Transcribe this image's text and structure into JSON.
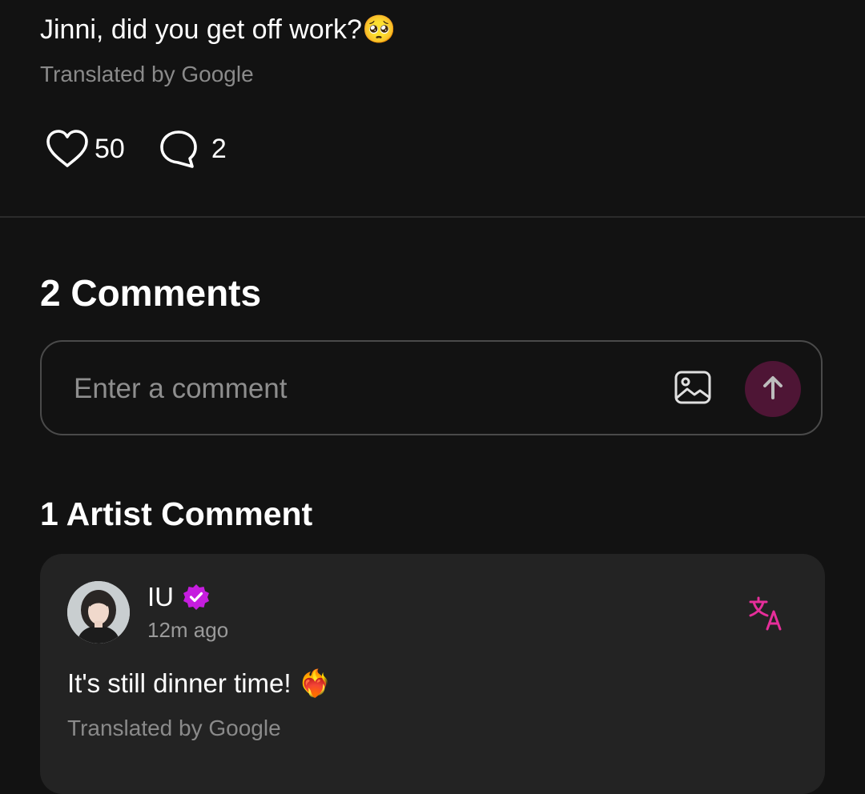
{
  "post": {
    "text": "Jinni, did you get off work?🥺",
    "translated_label": "Translated by Google",
    "likes": "50",
    "comments": "2"
  },
  "comments_section": {
    "title": "2 Comments",
    "input_placeholder": "Enter a comment"
  },
  "artist_section": {
    "title": "1 Artist Comment",
    "comment": {
      "author": "IU",
      "time": "12m ago",
      "text": "It's still dinner time! ❤️‍🔥",
      "translated_label": "Translated by Google"
    }
  },
  "icons": {
    "like": "heart-icon",
    "comment": "speech-bubble-icon",
    "image": "image-icon",
    "send": "arrow-up-icon",
    "verified": "verified-badge-icon",
    "translate": "translate-icon"
  },
  "colors": {
    "background": "#121212",
    "card": "#232323",
    "accent": "#e62e9a",
    "send_button": "#4e1535",
    "muted_text": "#8a8a8a"
  }
}
